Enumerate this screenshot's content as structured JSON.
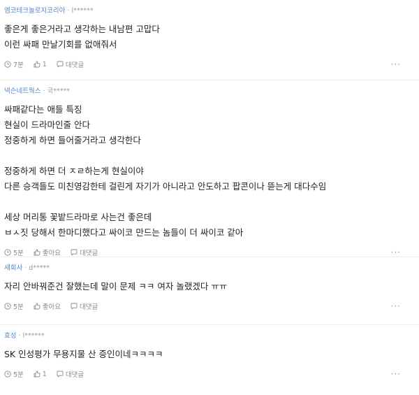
{
  "comments": [
    {
      "company": "엠코테크놀로지코리아",
      "author": "l******",
      "lines": [
        "좋은게 좋은거라고 생각하는 내남편 고맙다",
        "이런 싸패 만날기회를 없애줘서"
      ],
      "time": "7분",
      "likes": "1",
      "reply_label": "대댓글",
      "more": "···"
    },
    {
      "company": "넥슨네트웍스",
      "author": "국*****",
      "lines": [
        "싸패같다는 애들 특징",
        "현실이 드라마인줄 안다",
        "정중하게 하면 들어줄거라고 생각한다",
        "",
        "정중하게 하면 더 ㅈㄹ하는게 현실이야",
        "다른 승객들도 미친영감한테 걸린게 자기가 아니라고 안도하고 팝콘이나 뜯는게 대다수임",
        "",
        "세상 머리통 꽃밭드라마로 사는건 좋은데",
        "ㅂㅅ짓 당해서 한마디했다고 싸이코 만드는 놈들이 더 싸이코 같아"
      ],
      "time": "5분",
      "likes": "좋아요",
      "reply_label": "대댓글",
      "more": "···"
    },
    {
      "company": "새회사",
      "author": "d*****",
      "lines": [
        "자리 안바꿔준건 잘했는데 말이 문제 ㅋㅋ 여자 놀랬겠다 ㅠㅠ"
      ],
      "time": "5분",
      "likes": "좋아요",
      "reply_label": "대댓글",
      "more": "···"
    },
    {
      "company": "효성",
      "author": "l******",
      "lines": [
        "SK 인성평가 무용지물 산 증인이네ㅋㅋㅋㅋ"
      ],
      "time": "5분",
      "likes": "1",
      "reply_label": "대댓글",
      "more": "···"
    }
  ],
  "colors": {
    "company": "#4f86c6",
    "meta": "#8a8a8a",
    "text": "#222222",
    "divider": "#ececec"
  },
  "icons": {
    "time": "clock-icon",
    "like": "thumbs-up-icon",
    "reply": "speech-bubble-icon",
    "more": "more-dots-icon"
  }
}
